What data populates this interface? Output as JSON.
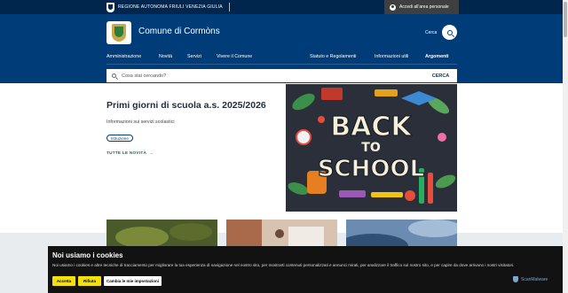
{
  "topbar": {
    "region_name": "REGIONE AUTONOMA FRIULI VENEZIA GIULIA",
    "login_label": "Accedi all'area personale"
  },
  "header": {
    "site_title": "Comune di Cormòns",
    "search_label": "Cerca",
    "nav_left": [
      "Amministrazione",
      "Novità",
      "Servizi",
      "Vivere il Comune"
    ],
    "nav_right": [
      "Statuto e Regolamenti",
      "Informazioni utili",
      "Argomenti"
    ],
    "search_placeholder": "Cosa stai cercando?",
    "search_button": "CERCA"
  },
  "hero": {
    "title": "Primi giorni di scuola a.s. 2025/2026",
    "description": "Informazioni sui servizi scolastici",
    "tag": "Istruzione",
    "all_news": "TUTTE LE NOVITÀ",
    "image_text": [
      "BACK",
      "TO",
      "SCHOOL"
    ]
  },
  "cookie": {
    "title": "Noi usiamo i cookies",
    "text": "Noi usiamo i cookies e altre tecniche di tracciamento per migliorare la tua esperienza di navigazione nel nostro sito, per mostrarti contenuti personalizzati e annunci mirati, per analizzare il traffico sul nostro sito, e per capire da dove arrivano i nostri visitatori.",
    "accept": "Accetta",
    "reject": "Rifiuta",
    "change": "Cambia le mie impostazioni",
    "badge": "ScanMalware"
  },
  "colors": {
    "topbar": "#00264d",
    "header": "#003c78",
    "cookie_bg": "#121212",
    "cookie_button": "#f5e10a",
    "link_green": "#1a6b3a"
  }
}
